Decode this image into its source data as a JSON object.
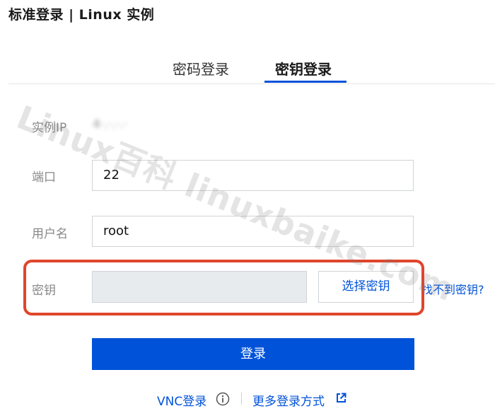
{
  "header": {
    "title": "标准登录 | Linux 实例"
  },
  "tabs": [
    {
      "label": "密码登录",
      "active": false
    },
    {
      "label": "密钥登录",
      "active": true
    }
  ],
  "form": {
    "ip": {
      "label": "实例IP",
      "value": "4·.·.·.·"
    },
    "port": {
      "label": "端口",
      "value": "22"
    },
    "username": {
      "label": "用户名",
      "value": "root"
    },
    "key": {
      "label": "密钥",
      "value": "",
      "select_button": "选择密钥",
      "help_link": "找不到密钥?"
    }
  },
  "login_button": "登录",
  "footer": {
    "vnc_label": "VNC登录",
    "more_label": "更多登录方式"
  },
  "watermark": "Linux百科 linuxbaike.com",
  "colors": {
    "accent": "#0052d9",
    "highlight": "#e0452b",
    "disabled_input": "#e8ebee"
  },
  "icons": {
    "info": "info-circle-icon",
    "external": "external-link-icon"
  }
}
